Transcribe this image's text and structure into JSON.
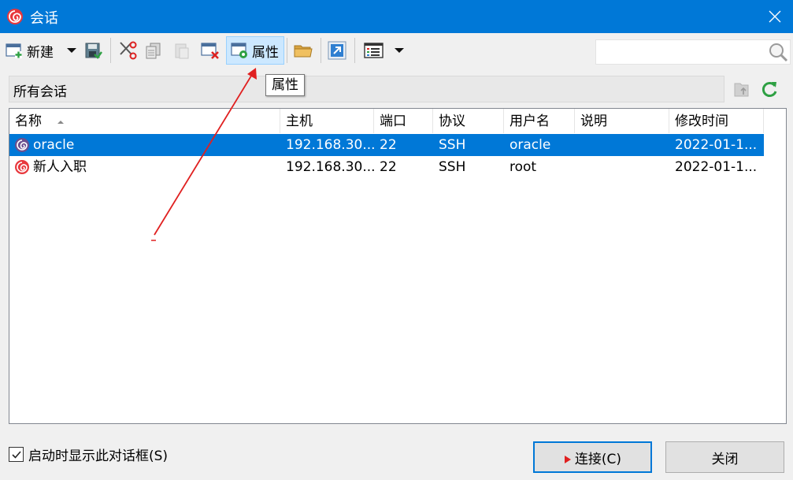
{
  "window": {
    "title": "会话",
    "close_glyph": "✕"
  },
  "toolbar": {
    "new_label": "新建",
    "properties_label": "属性"
  },
  "tooltip": {
    "text": "属性"
  },
  "search": {
    "placeholder": ""
  },
  "path": {
    "label": "所有会话"
  },
  "table": {
    "columns": [
      {
        "label": "名称",
        "sorted": "ascending"
      },
      {
        "label": "主机"
      },
      {
        "label": "端口"
      },
      {
        "label": "协议"
      },
      {
        "label": "用户名"
      },
      {
        "label": "说明"
      },
      {
        "label": "修改时间"
      }
    ],
    "rows": [
      {
        "name": "oracle",
        "host": "192.168.30...",
        "port": "22",
        "protocol": "SSH",
        "user": "oracle",
        "desc": "",
        "modified": "2022-01-1...",
        "selected": true
      },
      {
        "name": "新人入职",
        "host": "192.168.30...",
        "port": "22",
        "protocol": "SSH",
        "user": "root",
        "desc": "",
        "modified": "2022-01-1...",
        "selected": false
      }
    ]
  },
  "footer": {
    "show_on_startup_label": "启动时显示此对话框(S)",
    "show_on_startup_checked": true,
    "connect_label": "连接(C)",
    "close_label": "关闭"
  },
  "colors": {
    "accent": "#0078d7",
    "annotation": "#e02020"
  }
}
